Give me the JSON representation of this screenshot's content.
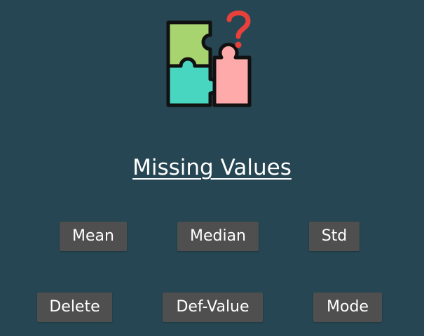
{
  "header": {
    "logo_icon": "puzzle-question-icon",
    "title": "Missing Values"
  },
  "colors": {
    "background": "#264653",
    "button_background": "#4f4f4f",
    "button_text": "#ffffff",
    "puzzle_green": "#a8d46f",
    "puzzle_teal": "#48d6c1",
    "puzzle_pink": "#ffaaaa",
    "question_mark": "#e8403a"
  },
  "buttons": {
    "mean": "Mean",
    "median": "Median",
    "std": "Std",
    "delete": "Delete",
    "def_value": "Def-Value",
    "mode": "Mode"
  }
}
